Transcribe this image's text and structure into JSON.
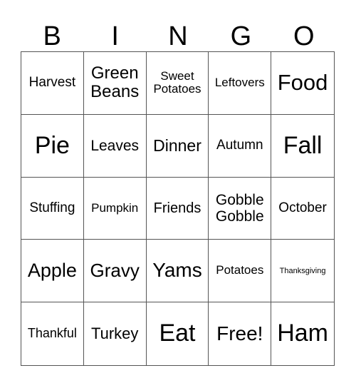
{
  "header": [
    "B",
    "I",
    "N",
    "G",
    "O"
  ],
  "cells": [
    {
      "text": "Harvest",
      "size": 19
    },
    {
      "text": "Green Beans",
      "size": 24
    },
    {
      "text": "Sweet Potatoes",
      "size": 17
    },
    {
      "text": "Leftovers",
      "size": 17
    },
    {
      "text": "Food",
      "size": 31
    },
    {
      "text": "Pie",
      "size": 34
    },
    {
      "text": "Leaves",
      "size": 21
    },
    {
      "text": "Dinner",
      "size": 23
    },
    {
      "text": "Autumn",
      "size": 19
    },
    {
      "text": "Fall",
      "size": 34
    },
    {
      "text": "Stuffing",
      "size": 19
    },
    {
      "text": "Pumpkin",
      "size": 17
    },
    {
      "text": "Friends",
      "size": 20
    },
    {
      "text": "Gobble Gobble",
      "size": 21
    },
    {
      "text": "October",
      "size": 19
    },
    {
      "text": "Apple",
      "size": 27
    },
    {
      "text": "Gravy",
      "size": 26
    },
    {
      "text": "Yams",
      "size": 28
    },
    {
      "text": "Potatoes",
      "size": 17
    },
    {
      "text": "Thanksgiving",
      "size": 11
    },
    {
      "text": "Thankful",
      "size": 18
    },
    {
      "text": "Turkey",
      "size": 22
    },
    {
      "text": "Eat",
      "size": 34
    },
    {
      "text": "Free!",
      "size": 28
    },
    {
      "text": "Ham",
      "size": 34
    }
  ]
}
